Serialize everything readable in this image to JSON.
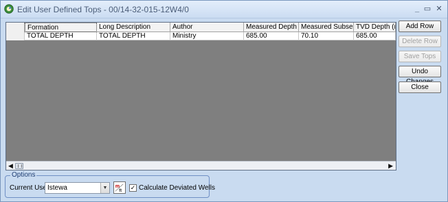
{
  "window": {
    "title": "Edit User Defined Tops - 00/14-32-015-12W4/0"
  },
  "grid": {
    "columns": [
      "Formation",
      "Long Description",
      "Author",
      "Measured Depth (m",
      "Measured Subsea (r",
      "TVD Depth (m)"
    ],
    "rows": [
      [
        "TOTAL DEPTH",
        "TOTAL DEPTH",
        "Ministry",
        "685.00",
        "70.10",
        "685.00"
      ]
    ]
  },
  "buttons": {
    "add_row": "Add Row",
    "delete_row": "Delete Row",
    "save_tops": "Save Tops",
    "undo_changes": "Undo Changes",
    "close": "Close"
  },
  "options": {
    "legend": "Options",
    "current_user_label": "Current User",
    "current_user_value": "Istewa",
    "calc_deviated_label": "Calculate Deviated Wells",
    "calc_deviated_checked": true
  }
}
